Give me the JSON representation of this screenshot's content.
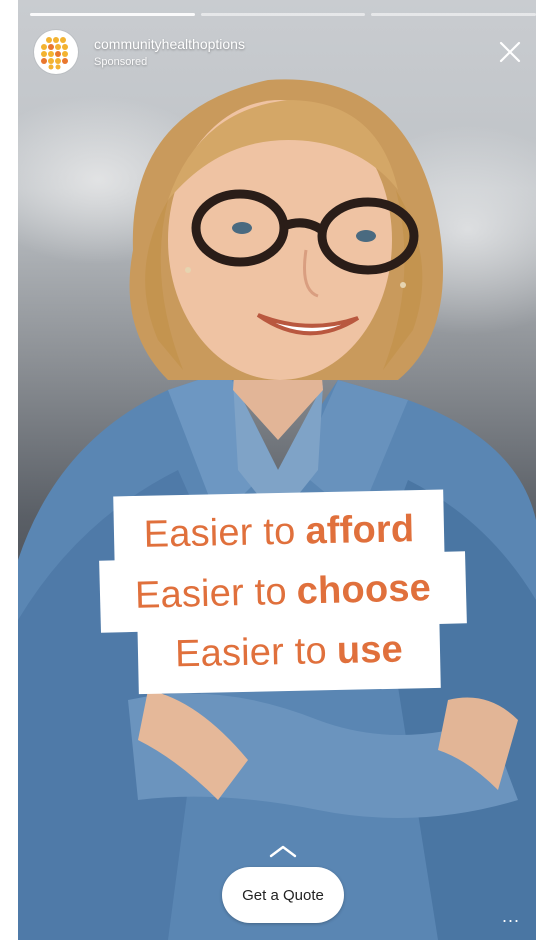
{
  "story": {
    "progress_segments": 3,
    "active_segments": 1
  },
  "header": {
    "handle": "communityhealthoptions",
    "sponsored_label": "Sponsored",
    "avatar_icon": "dot-grid-logo-icon",
    "close_icon": "close-icon"
  },
  "headline": {
    "line1_regular": "Easier to",
    "line1_bold": "afford",
    "line2_regular": "Easier to",
    "line2_bold": "choose",
    "line3_regular": "Easier to",
    "line3_bold": "use"
  },
  "cta": {
    "label": "Get a Quote",
    "swipe_icon": "chevron-up-icon"
  },
  "more_menu": {
    "label": "...",
    "icon": "more-options-icon"
  },
  "colors": {
    "headline_text": "#e0703c",
    "logo_gold": "#f3b331",
    "logo_orange": "#e9772e"
  }
}
